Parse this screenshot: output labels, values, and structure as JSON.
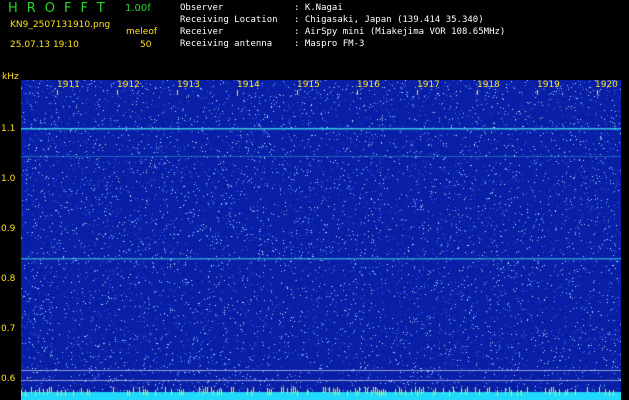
{
  "header": {
    "title": "HROFFT",
    "version": "1.00f",
    "filename": "KN9_2507131910.png",
    "station": "meleof",
    "datetime": "25.07.13 19:10",
    "count": "50"
  },
  "info": [
    {
      "key": "Observer",
      "value": ": K.Nagai"
    },
    {
      "key": "Receiving Location",
      "value": ": Chigasaki, Japan (139.414 35.340)"
    },
    {
      "key": "Receiver",
      "value": ": AirSpy mini (Miakejima VOR 108.65MHz)"
    },
    {
      "key": "Receiving antenna",
      "value": ": Maspro FM-3"
    }
  ],
  "spectrogram": {
    "y_unit": "kHz",
    "y_ticks": [
      "1.1",
      "1.0",
      "0.9",
      "0.8",
      "0.7",
      "0.6"
    ],
    "x_ticks": [
      "1911",
      "1912",
      "1913",
      "1914",
      "1915",
      "1916",
      "1917",
      "1918",
      "1919",
      "1920"
    ],
    "colors": {
      "background": "#0a1fa8",
      "signal": "#40e0f0",
      "noise": "#8ad8ff",
      "label": "#ffe01a"
    }
  }
}
